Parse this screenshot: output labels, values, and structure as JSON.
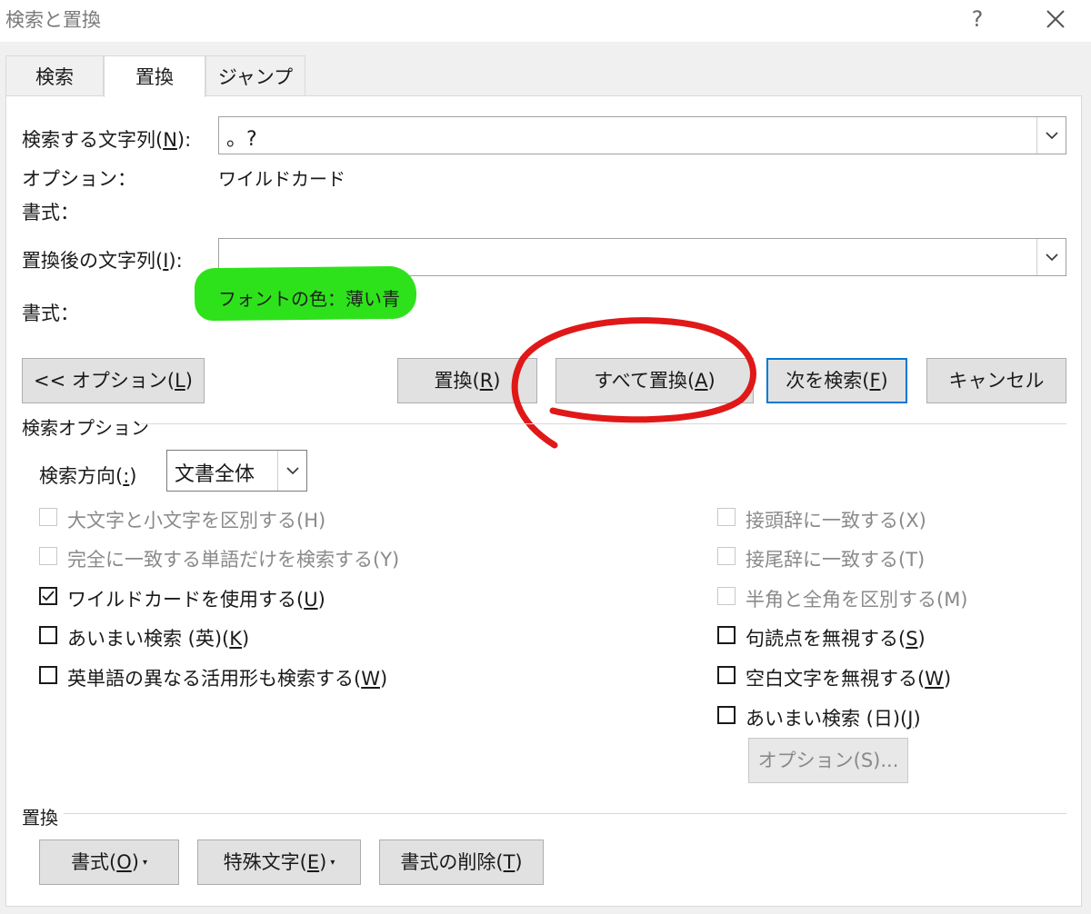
{
  "window": {
    "title": "検索と置換",
    "help": "?"
  },
  "tabs": [
    {
      "label": "検索"
    },
    {
      "label": "置換"
    },
    {
      "label": "ジャンプ"
    }
  ],
  "find": {
    "label_pre": "検索する文字列(",
    "label_key": "N",
    "label_post": "):",
    "value": "。?"
  },
  "options": {
    "label": "オプション：",
    "value": "ワイルドカード"
  },
  "find_format": {
    "label": "書式："
  },
  "replace": {
    "label_pre": "置換後の文字列(",
    "label_key": "I",
    "label_post": "):",
    "value": ""
  },
  "replace_format": {
    "label": "書式：",
    "value": "フォントの色：薄い青"
  },
  "buttons": {
    "less_options": {
      "pre": "<< オプション(",
      "key": "L",
      "post": ")"
    },
    "replace": {
      "pre": "置換(",
      "key": "R",
      "post": ")"
    },
    "replace_all": {
      "pre": "すべて置換(",
      "key": "A",
      "post": ")"
    },
    "find_next": {
      "pre": "次を検索(",
      "key": "F",
      "post": ")"
    },
    "cancel": "キャンセル"
  },
  "search_options": {
    "heading": "検索オプション",
    "direction": {
      "label_pre": "検索方向(",
      "label_key": ":",
      "label_post": ")",
      "value": "文書全体"
    },
    "left": [
      {
        "label": "大文字と小文字を区別する(H)",
        "checked": false,
        "disabled": true
      },
      {
        "label": "完全に一致する単語だけを検索する(Y)",
        "checked": false,
        "disabled": true
      },
      {
        "label_pre": "ワイルドカードを使用する(",
        "label_key": "U",
        "label_post": ")",
        "checked": true,
        "disabled": false
      },
      {
        "label_pre": "あいまい検索 (英)(",
        "label_key": "K",
        "label_post": ")",
        "checked": false,
        "disabled": false
      },
      {
        "label_pre": "英単語の異なる活用形も検索する(",
        "label_key": "W",
        "label_post": ")",
        "checked": false,
        "disabled": false
      }
    ],
    "right": [
      {
        "label": "接頭辞に一致する(X)",
        "checked": false,
        "disabled": true
      },
      {
        "label": "接尾辞に一致する(T)",
        "checked": false,
        "disabled": true
      },
      {
        "label": "半角と全角を区別する(M)",
        "checked": false,
        "disabled": true
      },
      {
        "label_pre": "句読点を無視する(",
        "label_key": "S",
        "label_post": ")",
        "checked": false,
        "disabled": false
      },
      {
        "label_pre": "空白文字を無視する(",
        "label_key": "W",
        "label_post": ")",
        "checked": false,
        "disabled": false
      },
      {
        "label_pre": "あいまい検索 (日)(",
        "label_key": "J",
        "label_post": ")",
        "checked": false,
        "disabled": false
      }
    ],
    "options_button": "オプション(S)..."
  },
  "replace_section": {
    "heading": "置換",
    "format_button": {
      "pre": "書式(",
      "key": "O",
      "post": ")"
    },
    "special_button": {
      "pre": "特殊文字(",
      "key": "E",
      "post": ")"
    },
    "clear_button": {
      "pre": "書式の削除(",
      "key": "T",
      "post": ")"
    }
  },
  "colors": {
    "accent": "#0078d7",
    "highlight": "#2ee21b",
    "annotation": "#e01818"
  }
}
